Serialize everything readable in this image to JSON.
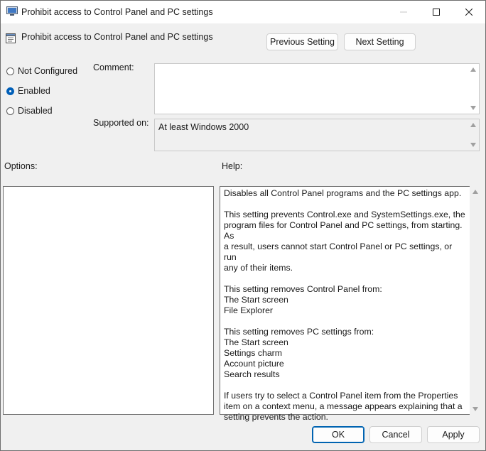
{
  "window": {
    "title": "Prohibit access to Control Panel and PC settings"
  },
  "header": {
    "setting_name": "Prohibit access to Control Panel and PC settings",
    "prev_label": "Previous Setting",
    "next_label": "Next Setting"
  },
  "state": {
    "options": [
      {
        "label": "Not Configured",
        "checked": false
      },
      {
        "label": "Enabled",
        "checked": true
      },
      {
        "label": "Disabled",
        "checked": false
      }
    ]
  },
  "comment": {
    "label": "Comment:",
    "value": ""
  },
  "supported": {
    "label": "Supported on:",
    "value": "At least Windows 2000"
  },
  "panels": {
    "options_label": "Options:",
    "help_label": "Help:"
  },
  "help": {
    "paragraphs": [
      [
        "Disables all Control Panel programs and the PC settings app."
      ],
      [
        "This setting prevents Control.exe and SystemSettings.exe, the",
        "program files for Control Panel and PC settings, from starting. As",
        "a result, users cannot start Control Panel or PC settings, or run",
        "any of their items."
      ],
      [
        "This setting removes Control Panel from:",
        "The Start screen",
        "File Explorer"
      ],
      [
        "This setting removes PC settings from:",
        "The Start screen",
        "Settings charm",
        "Account picture",
        "Search results"
      ],
      [
        "If users try to select a Control Panel item from the Properties",
        "item on a context menu, a message appears explaining that a",
        "setting prevents the action."
      ]
    ]
  },
  "footer": {
    "ok_label": "OK",
    "cancel_label": "Cancel",
    "apply_label": "Apply"
  },
  "colors": {
    "accent": "#005fb8",
    "window_bg": "#f0f0f0"
  }
}
